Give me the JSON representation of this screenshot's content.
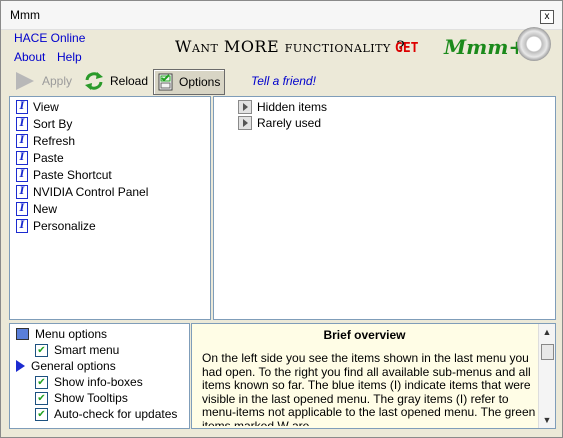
{
  "window": {
    "title": "Mmm",
    "close_label": "x"
  },
  "menu": {
    "hace_online": "HACE Online",
    "about": "About",
    "help": "Help"
  },
  "banner": {
    "tagline": "Want MORE functionality ?",
    "get": "GET",
    "brand": "Mmm+"
  },
  "toolbar": {
    "apply": "Apply",
    "reload": "Reload",
    "options": "Options",
    "tell_friend": "Tell a friend!"
  },
  "menu_items": [
    "View",
    "Sort By",
    "Refresh",
    "Paste",
    "Paste Shortcut",
    "NVIDIA Control Panel",
    "New",
    "Personalize"
  ],
  "folders": [
    "Hidden items",
    "Rarely used"
  ],
  "options": {
    "menu_options": "Menu options",
    "smart_menu": "Smart menu",
    "general_options": "General options",
    "show_info_boxes": "Show info-boxes",
    "show_tooltips": "Show Tooltips",
    "auto_check": "Auto-check for updates"
  },
  "overview": {
    "title": "Brief overview",
    "text": "On the left side you see the items shown in the last menu you had open. To the right you find all available sub-menus and all items known so far. The blue items (I) indicate items that were visible in the last opened menu. The gray items (I) refer to menu-items not applicable to the last opened menu. The green items marked W are"
  },
  "colors": {
    "link": "#0000cc",
    "check": "#21a121",
    "item_icon": "#1c2bd0",
    "brand": "#1b8a1b",
    "get": "#dd0000"
  }
}
